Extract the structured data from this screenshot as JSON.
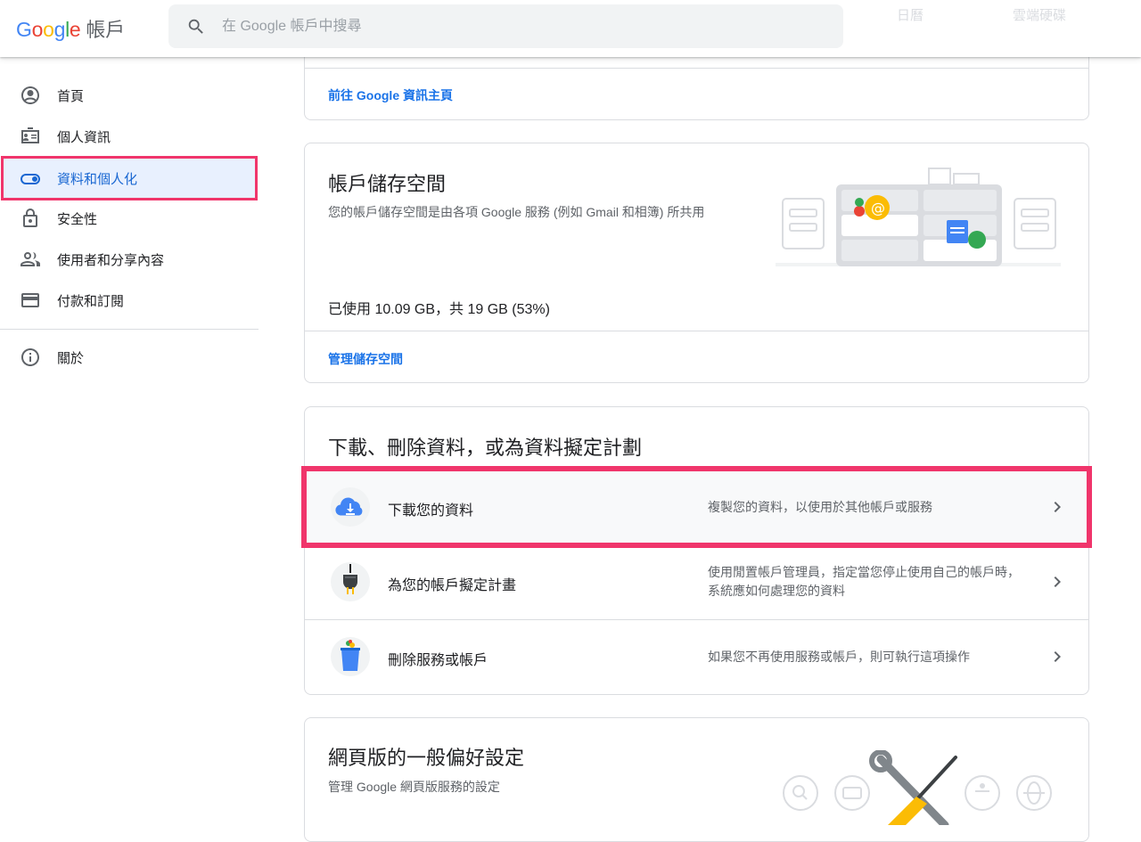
{
  "header": {
    "logo_google": "Google",
    "product": "帳戶",
    "search_placeholder": "在 Google 帳戶中搜尋",
    "faded_link_1": "日曆",
    "faded_link_2": "雲端硬碟"
  },
  "sidebar": {
    "items": [
      {
        "label": "首頁",
        "icon": "account-circle-icon"
      },
      {
        "label": "個人資訊",
        "icon": "id-card-icon"
      },
      {
        "label": "資料和個人化",
        "icon": "toggle-icon",
        "active": true
      },
      {
        "label": "安全性",
        "icon": "lock-icon"
      },
      {
        "label": "使用者和分享內容",
        "icon": "people-icon"
      },
      {
        "label": "付款和訂閱",
        "icon": "credit-card-icon"
      }
    ],
    "about": {
      "label": "關於",
      "icon": "info-icon"
    }
  },
  "cards": {
    "dashboard": {
      "link": "前往 Google 資訊主頁"
    },
    "storage": {
      "title": "帳戶儲存空間",
      "subtitle": "您的帳戶儲存空間是由各項 Google 服務 (例如 Gmail 和相簿) 所共用",
      "usage": "已使用 10.09 GB，共 19 GB (53%)",
      "link": "管理儲存空間"
    },
    "download": {
      "title": "下載、刪除資料，或為資料擬定計劃",
      "rows": [
        {
          "title": "下載您的資料",
          "desc": "複製您的資料，以使用於其他帳戶或服務",
          "icon": "cloud-download-icon"
        },
        {
          "title": "為您的帳戶擬定計畫",
          "desc": "使用閒置帳戶管理員，指定當您停止使用自己的帳戶時，系統應如何處理您的資料",
          "icon": "plug-icon"
        },
        {
          "title": "刪除服務或帳戶",
          "desc": "如果您不再使用服務或帳戶，則可執行這項操作",
          "icon": "trash-can-icon"
        }
      ]
    },
    "web_prefs": {
      "title": "網頁版的一般偏好設定",
      "subtitle": "管理 Google 網頁版服務的設定"
    }
  },
  "colors": {
    "accent": "#1a73e8",
    "highlight": "#f0356b",
    "active_bg": "#e8f0fe"
  }
}
